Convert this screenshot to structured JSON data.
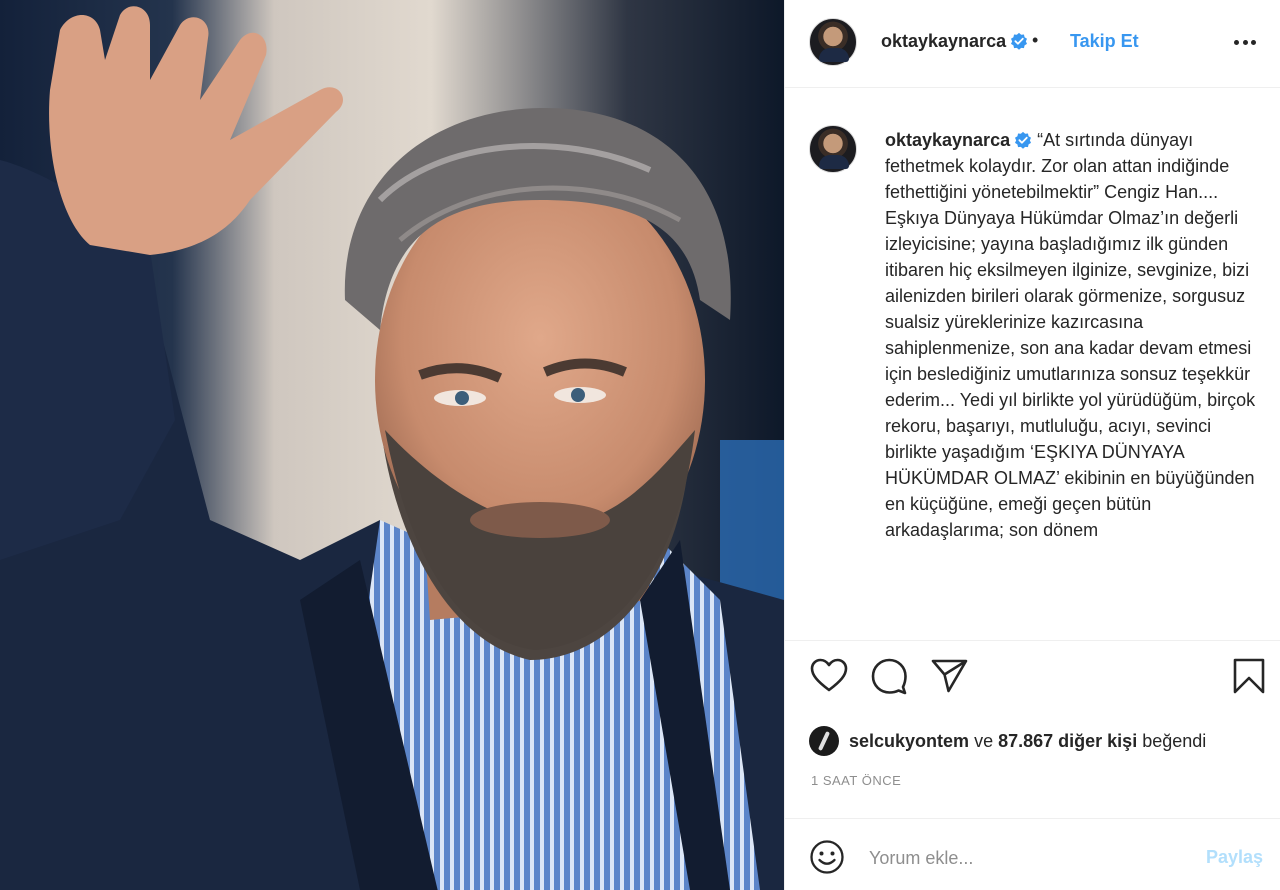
{
  "post": {
    "username": "oktaykaynarca",
    "follow_label": "Takip Et",
    "separator": "•",
    "caption": "“At sırtında dünyayı fethetmek kolaydır. Zor olan attan indiğinde fethettiğini yönetebilmektir” Cengiz Han....\nEşkıya Dünyaya Hükümdar Olmaz’ın değerli izleyicisine; yayına başladığımız ilk günden itibaren hiç eksilmeyen ilginize, sevginize, bizi ailenizden birileri olarak görmenize, sorgusuz sualsiz yüreklerinize kazırcasına sahiplenmenize, son ana kadar devam etmesi için beslediğiniz umutlarınıza sonsuz teşekkür ederim... Yedi yıl birlikte yol yürüdüğüm, birçok rekoru, başarıyı, mutluluğu, acıyı, sevinci birlikte yaşadığım ‘EŞKIYA DÜNYAYA HÜKÜMDAR OLMAZ’ ekibinin en büyüğünden en küçüğüne, emeği geçen bütün arkadaşlarıma; son dönem"
  },
  "likes": {
    "liker": "selcukyontem",
    "connector": "ve",
    "others": "87.867 diğer kişi",
    "suffix": "beğendi"
  },
  "timestamp": "1 SAAT ÖNCE",
  "comment": {
    "placeholder": "Yorum ekle...",
    "post_label": "Paylaş"
  },
  "icons": {
    "verified": "verified-badge-icon",
    "more": "more-options-icon",
    "like": "heart-icon",
    "comment": "comment-bubble-icon",
    "share": "paper-plane-icon",
    "save": "bookmark-icon",
    "emoji": "smiley-icon"
  },
  "colors": {
    "accent": "#3897f0",
    "verified": "#3897f0",
    "text": "#262626",
    "muted": "#8e8e8e",
    "post_disabled": "#b2dffc"
  }
}
